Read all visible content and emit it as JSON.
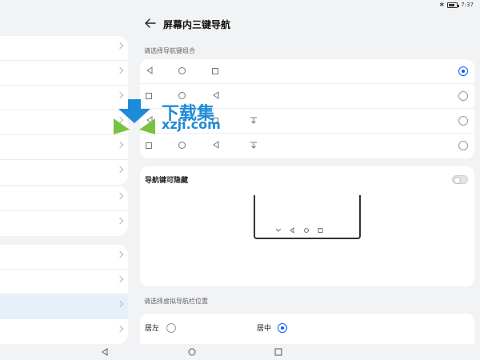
{
  "status_bar": {
    "time": "7:37",
    "bluetooth_icon": "bluetooth-icon",
    "battery_icon": "battery-icon"
  },
  "header": {
    "title": "屏幕内三键导航",
    "back_icon": "back-arrow-icon"
  },
  "nav_combo": {
    "label": "请选择导航键组合",
    "options": [
      {
        "icons": [
          "back-triangle-icon",
          "home-circle-icon",
          "recent-square-icon"
        ],
        "selected": true
      },
      {
        "icons": [
          "recent-square-icon",
          "home-circle-icon",
          "back-triangle-icon"
        ],
        "selected": false
      },
      {
        "icons": [
          "back-triangle-icon",
          "home-circle-icon",
          "recent-square-icon",
          "notification-pulldown-icon"
        ],
        "selected": false
      },
      {
        "icons": [
          "recent-square-icon",
          "home-circle-icon",
          "back-triangle-icon",
          "notification-pulldown-icon"
        ],
        "selected": false
      }
    ]
  },
  "hideable": {
    "title": "导航键可隐藏",
    "enabled": false
  },
  "position": {
    "label": "请选择虚拟导航栏位置",
    "options": [
      {
        "label": "居左",
        "selected": false
      },
      {
        "label": "居中",
        "selected": true
      }
    ]
  },
  "watermark": {
    "title": "下载集",
    "url": "xzji.com"
  },
  "colors": {
    "accent": "#0a59f7",
    "background": "#f1f3f5",
    "selected_row": "#e6f0fb",
    "watermark": "#1e8bd8"
  }
}
